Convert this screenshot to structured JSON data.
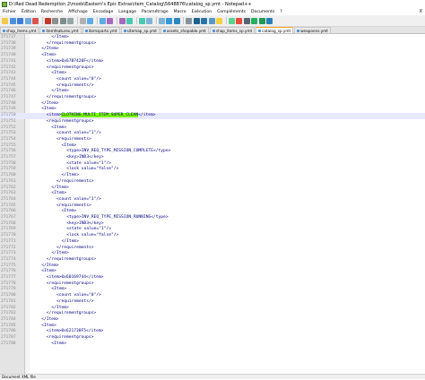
{
  "window": {
    "title": "D:\\Red Dead Redemption 2\\mods\\Eastern's Epic Extras\\item_Catalog\\5648876\\catalog_sp.ymt - Notepad++"
  },
  "menu": [
    "Fichier",
    "Édition",
    "Recherche",
    "Affichage",
    "Encodage",
    "Langage",
    "Paramétrage",
    "Macro",
    "Exécution",
    "Compléments",
    "Documents",
    "?"
  ],
  "menu_right": "X",
  "toolbar": {
    "buttons": [
      "new-icon",
      "open-icon",
      "save-icon",
      "save-all-icon",
      "close-icon",
      "close-all-icon",
      "print-icon",
      "cut-icon",
      "copy-icon",
      "paste-icon",
      "undo-icon",
      "redo-icon",
      "find-icon",
      "replace-icon",
      "zoom-in-icon",
      "zoom-out-icon",
      "sync-v-icon",
      "sync-h-icon",
      "wrap-icon",
      "all-chars-icon",
      "indent-guide-icon",
      "lang-icon",
      "doc-map-icon",
      "func-list-icon",
      "folder-icon",
      "monitor-icon",
      "record-icon",
      "stop-icon",
      "play-icon",
      "play-multi-icon",
      "save-macro-icon"
    ]
  },
  "tabs": [
    {
      "label": "shop_items.ymt",
      "active": false
    },
    {
      "label": "itemfeatures.ymt",
      "active": false
    },
    {
      "label": "itemsparts.ymt",
      "active": false
    },
    {
      "label": "sitemap_sp.ymt",
      "active": false
    },
    {
      "label": "assets_shopable.ymt",
      "active": false
    },
    {
      "label": "shop_items_sp.ymt",
      "active": false
    },
    {
      "label": "catalog_sp.ymt",
      "active": true
    },
    {
      "label": "weaponns.ymt",
      "active": false
    }
  ],
  "editor": {
    "lines": [
      {
        "n": "271737",
        "indent": 8,
        "text": "</Item>"
      },
      {
        "n": "271738",
        "indent": 6,
        "text": "</requirementgroups>"
      },
      {
        "n": "271739",
        "indent": 4,
        "text": "</Item>"
      },
      {
        "n": "271740",
        "indent": 4,
        "text": "<Item>"
      },
      {
        "n": "271741",
        "indent": 6,
        "text": "<item>0x67B7420F</item>"
      },
      {
        "n": "271742",
        "indent": 6,
        "text": "<requirementgroups>"
      },
      {
        "n": "271743",
        "indent": 8,
        "text": "<Item>"
      },
      {
        "n": "271744",
        "indent": 10,
        "text": "<count value=\"0\"/>"
      },
      {
        "n": "271745",
        "indent": 10,
        "text": "<requirements/>"
      },
      {
        "n": "271746",
        "indent": 8,
        "text": "</Item>"
      },
      {
        "n": "271747",
        "indent": 6,
        "text": "</requirementgroups>"
      },
      {
        "n": "271748",
        "indent": 4,
        "text": "</Item>"
      },
      {
        "n": "271749",
        "indent": 4,
        "text": "<Item>"
      },
      {
        "n": "271750",
        "indent": 6,
        "text": "<item>",
        "hl": "CLOTHING_MULTI_ITEM_SUPER_CLEAN",
        "after": "</item>",
        "current": true
      },
      {
        "n": "271751",
        "indent": 6,
        "text": "<requirementgroups>"
      },
      {
        "n": "271752",
        "indent": 8,
        "text": "<Item>"
      },
      {
        "n": "271753",
        "indent": 10,
        "text": "<count value=\"1\"/>"
      },
      {
        "n": "271754",
        "indent": 10,
        "text": "<requirements>"
      },
      {
        "n": "271755",
        "indent": 12,
        "text": "<Item>"
      },
      {
        "n": "271756",
        "indent": 14,
        "text": "<type>INV_REQ_TYPE_MISSION_COMPLETE</type>"
      },
      {
        "n": "271757",
        "indent": 14,
        "text": "<key>IND3</key>"
      },
      {
        "n": "271758",
        "indent": 14,
        "text": "<state value=\"1\"/>"
      },
      {
        "n": "271759",
        "indent": 14,
        "text": "<lock value=\"false\"/>"
      },
      {
        "n": "271760",
        "indent": 12,
        "text": "</Item>"
      },
      {
        "n": "271761",
        "indent": 10,
        "text": "</requirements>"
      },
      {
        "n": "271762",
        "indent": 8,
        "text": "</Item>"
      },
      {
        "n": "271763",
        "indent": 8,
        "text": "<Item>"
      },
      {
        "n": "271764",
        "indent": 10,
        "text": "<count value=\"1\"/>"
      },
      {
        "n": "271765",
        "indent": 10,
        "text": "<requirements>"
      },
      {
        "n": "271766",
        "indent": 12,
        "text": "<Item>"
      },
      {
        "n": "271767",
        "indent": 14,
        "text": "<type>INV_REQ_TYPE_MISSION_RUNNING</type>"
      },
      {
        "n": "271768",
        "indent": 14,
        "text": "<key>IND3</key>"
      },
      {
        "n": "271769",
        "indent": 14,
        "text": "<state value=\"1\"/>"
      },
      {
        "n": "271770",
        "indent": 14,
        "text": "<lock value=\"false\"/>"
      },
      {
        "n": "271771",
        "indent": 12,
        "text": "</Item>"
      },
      {
        "n": "271772",
        "indent": 10,
        "text": "</requirements>"
      },
      {
        "n": "271773",
        "indent": 8,
        "text": "</Item>"
      },
      {
        "n": "271774",
        "indent": 6,
        "text": "</requirementgroups>"
      },
      {
        "n": "271775",
        "indent": 4,
        "text": "</Item>"
      },
      {
        "n": "271776",
        "indent": 4,
        "text": "<Item>"
      },
      {
        "n": "271777",
        "indent": 6,
        "text": "<item>0x60169744</item>"
      },
      {
        "n": "271778",
        "indent": 6,
        "text": "<requirementgroups>"
      },
      {
        "n": "271779",
        "indent": 8,
        "text": "<Item>"
      },
      {
        "n": "271780",
        "indent": 10,
        "text": "<count value=\"0\"/>"
      },
      {
        "n": "271781",
        "indent": 10,
        "text": "<requirements/>"
      },
      {
        "n": "271782",
        "indent": 8,
        "text": "</Item>"
      },
      {
        "n": "271783",
        "indent": 6,
        "text": "</requirementgroups>"
      },
      {
        "n": "271784",
        "indent": 4,
        "text": "</Item>"
      },
      {
        "n": "271785",
        "indent": 4,
        "text": "<Item>"
      },
      {
        "n": "271786",
        "indent": 6,
        "text": "<item>0x621738F5</item>"
      },
      {
        "n": "271787",
        "indent": 6,
        "text": "<requirementgroups>"
      },
      {
        "n": "271788",
        "indent": 8,
        "text": "<Item>"
      }
    ]
  },
  "status": {
    "text": "Document XML file"
  },
  "colors": {
    "highlight": "#7CFC00",
    "tag": "#000080",
    "gutter": "#e4e4e4"
  }
}
